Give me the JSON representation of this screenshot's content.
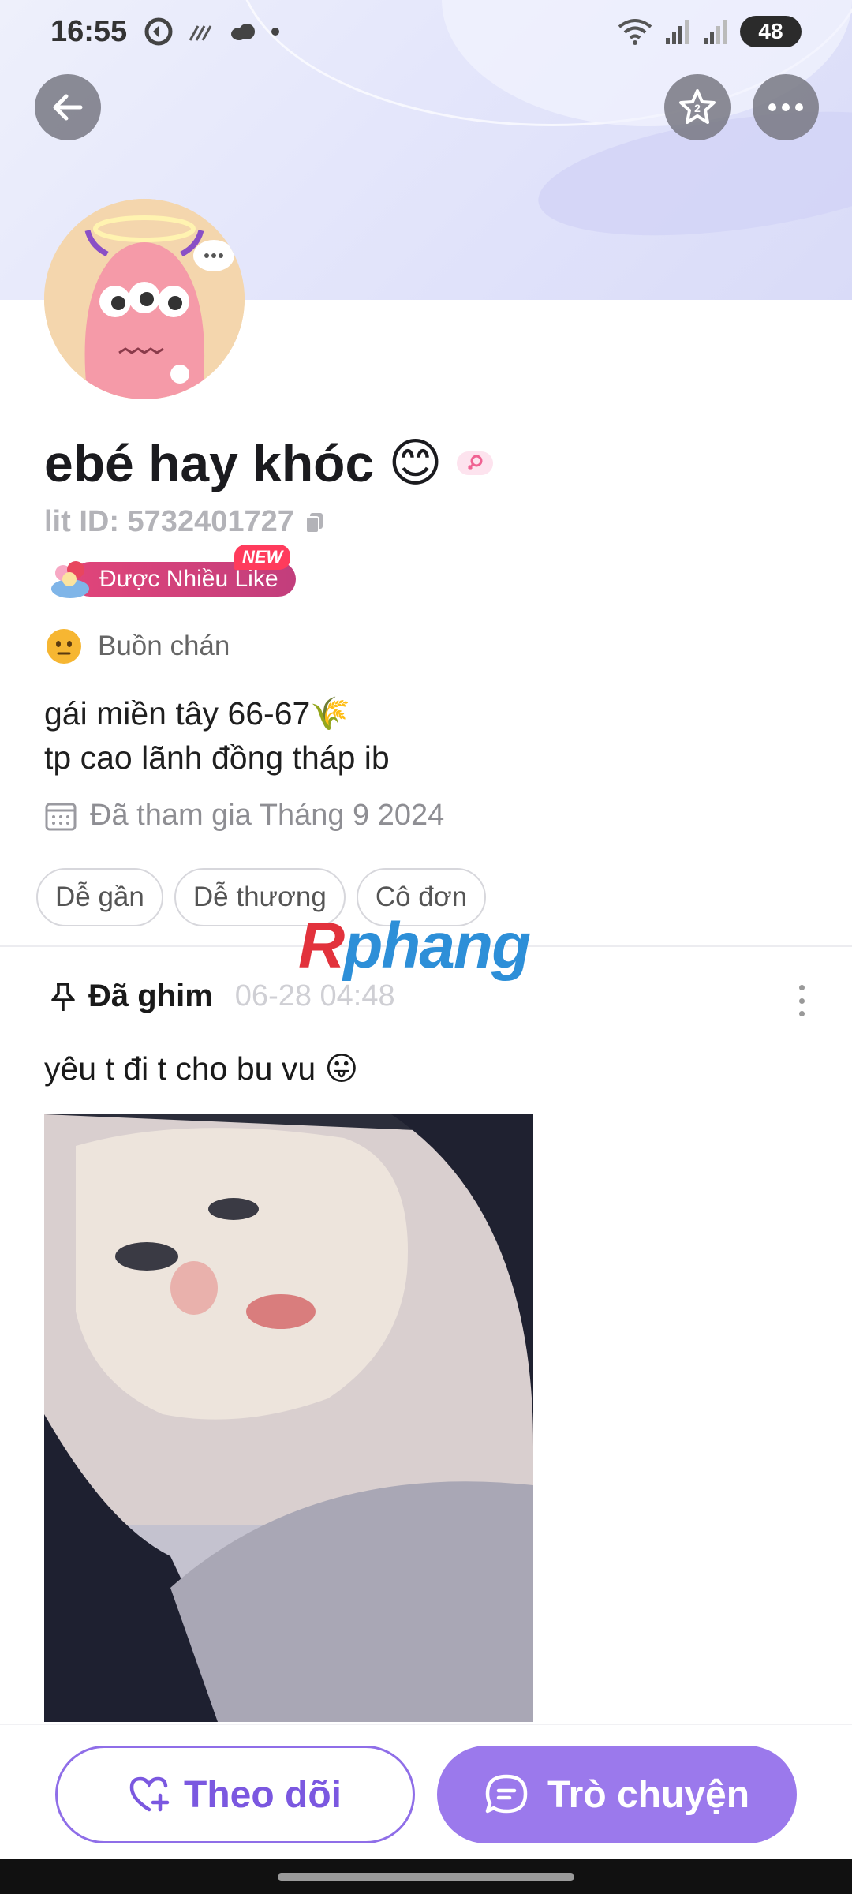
{
  "status_bar": {
    "time": "16:55",
    "battery": "48"
  },
  "header": {
    "back_icon": "arrow-left-icon",
    "star_icon": "star-icon",
    "more_icon": "more-horizontal-icon"
  },
  "profile": {
    "name": "ebé hay khóc",
    "name_emoji": "😊",
    "lit_id": "lit ID: 5732401727",
    "badge_label": "Được Nhiều Like",
    "badge_new": "NEW",
    "mood": "Buồn chán",
    "bio_line1": "gái miền tây 66-67🌾",
    "bio_line2": "tp cao lãnh đồng tháp ib",
    "joined": "Đã tham gia Tháng 9 2024",
    "tags": [
      "Dễ gần",
      "Dễ thương",
      "Cô đơn"
    ]
  },
  "watermark": {
    "part1": "R",
    "part2": "phang"
  },
  "post": {
    "pinned_label": "Đã ghim",
    "time": "06-28 04:48",
    "text": "yêu t đi t cho bu vu 😛"
  },
  "actions": {
    "follow_label": "Theo dõi",
    "chat_label": "Trò chuyện"
  },
  "colors": {
    "accent": "#9b79ec",
    "badge_pink": "#e0457a",
    "new_tag": "#ff3b5c"
  }
}
